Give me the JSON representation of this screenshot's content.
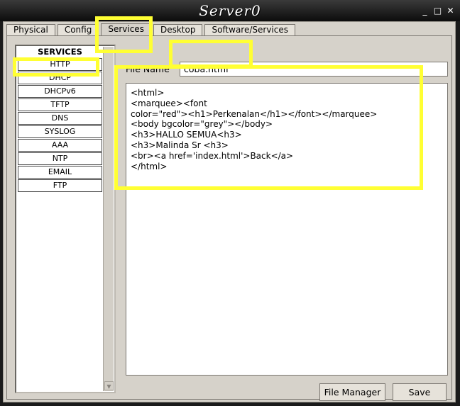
{
  "window": {
    "title": "Server0",
    "minimize": "_",
    "maximize": "□",
    "close": "✕"
  },
  "tabs": [
    {
      "label": "Physical"
    },
    {
      "label": "Config"
    },
    {
      "label": "Services"
    },
    {
      "label": "Desktop"
    },
    {
      "label": "Software/Services"
    }
  ],
  "services": {
    "header": "SERVICES",
    "items": [
      {
        "label": "HTTP"
      },
      {
        "label": "DHCP"
      },
      {
        "label": "DHCPv6"
      },
      {
        "label": "TFTP"
      },
      {
        "label": "DNS"
      },
      {
        "label": "SYSLOG"
      },
      {
        "label": "AAA"
      },
      {
        "label": "NTP"
      },
      {
        "label": "EMAIL"
      },
      {
        "label": "FTP"
      }
    ]
  },
  "http": {
    "file_name_label": "File Name",
    "file_name_value": "coba.html",
    "content": "<html>\n<marquee><font\ncolor=\"red\"><h1>Perkenalan</h1></font></marquee>\n<body bgcolor=\"grey\"></body>\n<h3>HALLO SEMUA<h3>\n<h3>Malinda Sr <h3>\n<br><a href='index.html'>Back</a>\n</html>",
    "file_manager_label": "File Manager",
    "save_label": "Save"
  },
  "colors": {
    "highlight": "#ffff33",
    "panel": "#d6d2ca"
  }
}
